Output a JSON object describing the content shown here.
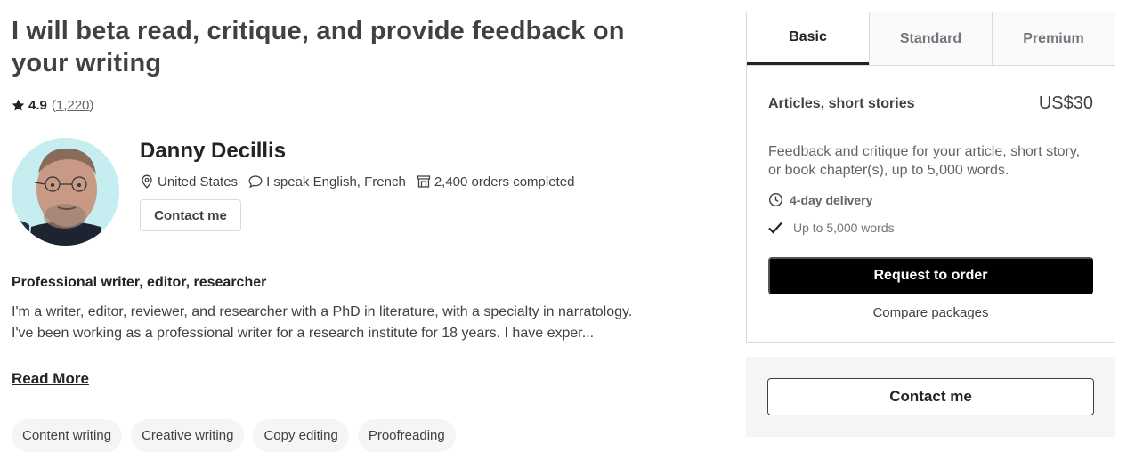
{
  "gig": {
    "title": "I will beta read, critique, and provide feedback on your writing",
    "rating": "4.9",
    "review_count": "1,220"
  },
  "seller": {
    "name": "Danny Decillis",
    "country": "United States",
    "languages": "I speak English, French",
    "orders": "2,400 orders completed",
    "contact_label": "Contact me"
  },
  "about": {
    "headline": "Professional writer, editor, researcher",
    "description": "I'm a writer, editor, reviewer, and researcher with a PhD in literature, with a specialty in narratology. I've been working as a professional writer for a research institute for 18 years. I have exper...",
    "read_more": "Read More"
  },
  "tags": [
    "Content writing",
    "Creative writing",
    "Copy editing",
    "Proofreading"
  ],
  "package": {
    "tabs": [
      "Basic",
      "Standard",
      "Premium"
    ],
    "active_tab": "Basic",
    "name": "Articles, short stories",
    "price": "US$30",
    "description": "Feedback and critique for your article, short story, or book chapter(s), up to 5,000 words.",
    "delivery": "4-day delivery",
    "feature": "Up to 5,000 words",
    "order_label": "Request to order",
    "compare_label": "Compare packages"
  },
  "contact_box": {
    "label": "Contact me"
  },
  "icons": {
    "star": "star-icon",
    "location": "location-pin-icon",
    "chat": "chat-bubble-icon",
    "orders": "store-icon",
    "clock": "clock-icon",
    "check": "checkmark-icon"
  }
}
